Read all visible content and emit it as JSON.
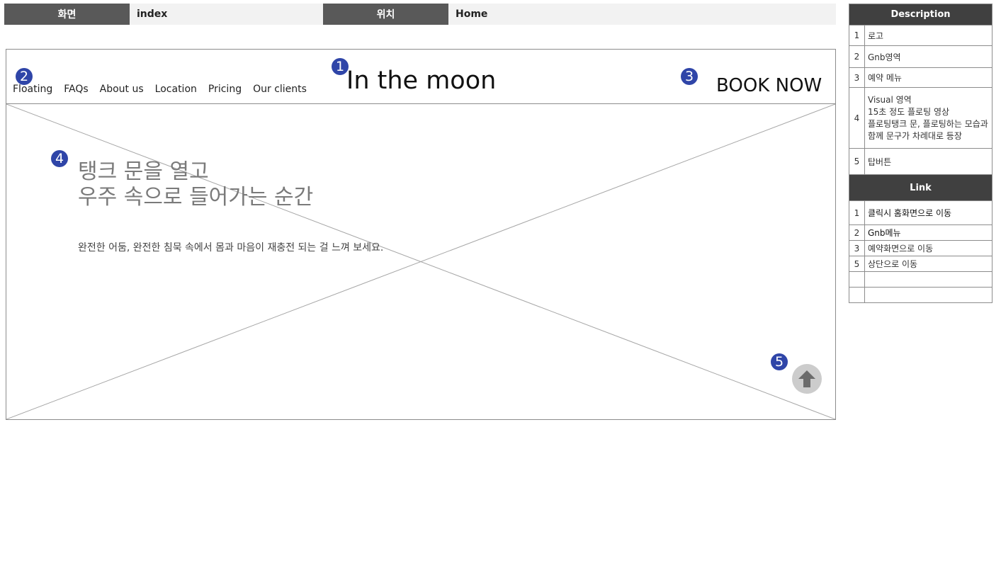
{
  "header": {
    "screen_label": "화면",
    "screen_value": "index",
    "location_label": "위치",
    "location_value": "Home"
  },
  "wireframe": {
    "nav_items": [
      "Floating",
      "FAQs",
      "About us",
      "Location",
      "Pricing",
      "Our clients"
    ],
    "logo": "In the moon",
    "book_button": "BOOK NOW",
    "hero_line1": "탱크 문을 열고",
    "hero_line2": "우주 속으로 들어가는 순간",
    "hero_sub": "완전한 어둠, 완전한 침묵 속에서 몸과 마음이 재충전 되는 걸 느껴 보세요.",
    "markers": [
      "1",
      "2",
      "3",
      "4",
      "5"
    ]
  },
  "description": {
    "title": "Description",
    "rows": [
      {
        "num": "1",
        "text": "로고"
      },
      {
        "num": "2",
        "text": "Gnb영역"
      },
      {
        "num": "3",
        "text": "예약 메뉴"
      },
      {
        "num": "4",
        "text": "Visual 영역\n15초 정도 플로팅 영상\n플로팅탱크 문, 플로팅하는 모습과 함께 문구가 차례대로 등장"
      },
      {
        "num": "5",
        "text": "탑버튼"
      }
    ]
  },
  "link": {
    "title": "Link",
    "rows": [
      {
        "num": "1",
        "text": "클릭시 홈화면으로 이동"
      },
      {
        "num": "2",
        "text": "Gnb메뉴"
      },
      {
        "num": "3",
        "text": "예약화면으로 이동"
      },
      {
        "num": "5",
        "text": "상단으로 이동"
      },
      {
        "num": "",
        "text": ""
      },
      {
        "num": "",
        "text": ""
      }
    ]
  },
  "colors": {
    "marker": "#2f45a8",
    "header_dark": "#595959",
    "header_light": "#f2f2f2",
    "table_header": "#404040"
  },
  "icons": [
    "arrow-up-icon"
  ]
}
